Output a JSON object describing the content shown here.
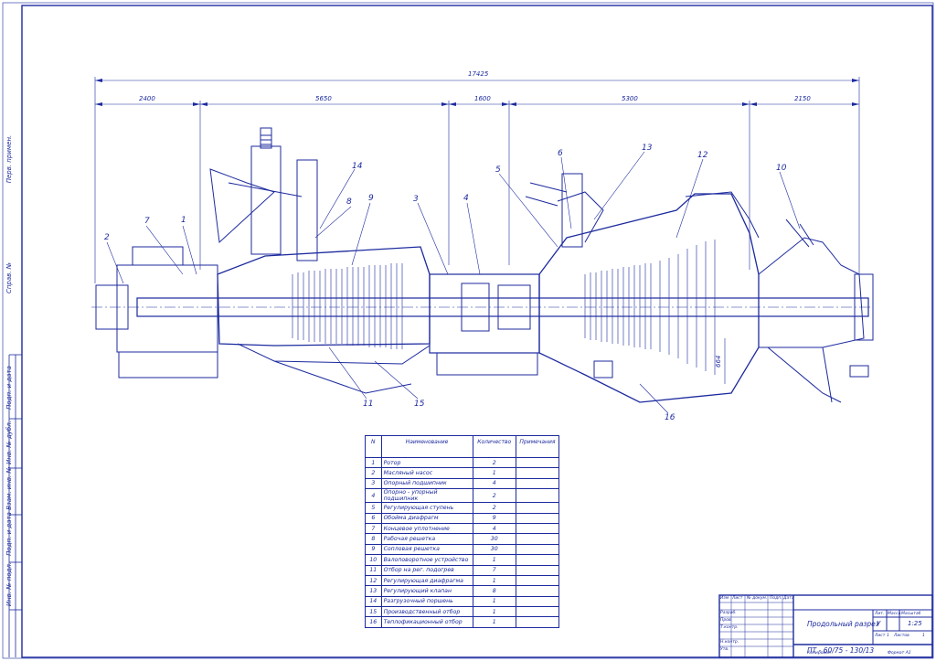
{
  "dimensions": {
    "total": "17425",
    "segments": [
      "2400",
      "5650",
      "1600",
      "5300",
      "2150"
    ],
    "vertical": "664"
  },
  "callouts": [
    "1",
    "2",
    "3",
    "4",
    "5",
    "6",
    "7",
    "8",
    "9",
    "10",
    "11",
    "12",
    "13",
    "14",
    "15",
    "16"
  ],
  "table": {
    "headers": {
      "n": "N",
      "name": "Наименование",
      "qty": "Количество",
      "note": "Примечания"
    },
    "rows": [
      {
        "n": "1",
        "name": "Ротор",
        "qty": "2"
      },
      {
        "n": "2",
        "name": "Масляный насос",
        "qty": "1"
      },
      {
        "n": "3",
        "name": "Опорный подшипник",
        "qty": "4"
      },
      {
        "n": "4",
        "name": "Опорно - упорный подшипник",
        "qty": "2"
      },
      {
        "n": "5",
        "name": "Регулирующая ступень",
        "qty": "2"
      },
      {
        "n": "6",
        "name": "Обойма диафрагм",
        "qty": "9"
      },
      {
        "n": "7",
        "name": "Концевое уплотнение",
        "qty": "4"
      },
      {
        "n": "8",
        "name": "Рабочая решетка",
        "qty": "30"
      },
      {
        "n": "9",
        "name": "Сопловая решетка",
        "qty": "30"
      },
      {
        "n": "10",
        "name": "Валоповоротное устройство",
        "qty": "1"
      },
      {
        "n": "11",
        "name": "Отбор на рег. подогрев",
        "qty": "7"
      },
      {
        "n": "12",
        "name": "Регулирующая диафрагма",
        "qty": "1"
      },
      {
        "n": "13",
        "name": "Регулирующий клапан",
        "qty": "8"
      },
      {
        "n": "14",
        "name": "Разгрузочный поршень",
        "qty": "1"
      },
      {
        "n": "15",
        "name": "Производственный отбор",
        "qty": "1"
      },
      {
        "n": "16",
        "name": "Теплофикационный отбор",
        "qty": "1"
      }
    ]
  },
  "title_block": {
    "drawing_title": "Продольный разрез",
    "designation": "ПТ - 60/75 - 130/13",
    "lit_label": "Лит.",
    "lit_value": "У",
    "mass_label": "Масса",
    "scale_label": "Масштаб",
    "scale_value": "1:25",
    "sheet_label": "Лист",
    "sheet_value": "1",
    "sheets_label": "Листов",
    "sheets_value": "1",
    "copied": "Копировал",
    "format": "Формат  А1",
    "rows_left": [
      "Изм",
      "Разраб.",
      "Пров.",
      "Т.контр.",
      "Н.контр.",
      "Утв."
    ],
    "cols_left": [
      "Лист",
      "№ докум.",
      "Подп.",
      "Дата"
    ]
  },
  "side_stamp": [
    "Подп. и дата",
    "Инв. № дубл.",
    "Взам. инв. №",
    "Подп. и дата",
    "Инв. № подл.",
    "Справ. №",
    "Перв. примен."
  ]
}
